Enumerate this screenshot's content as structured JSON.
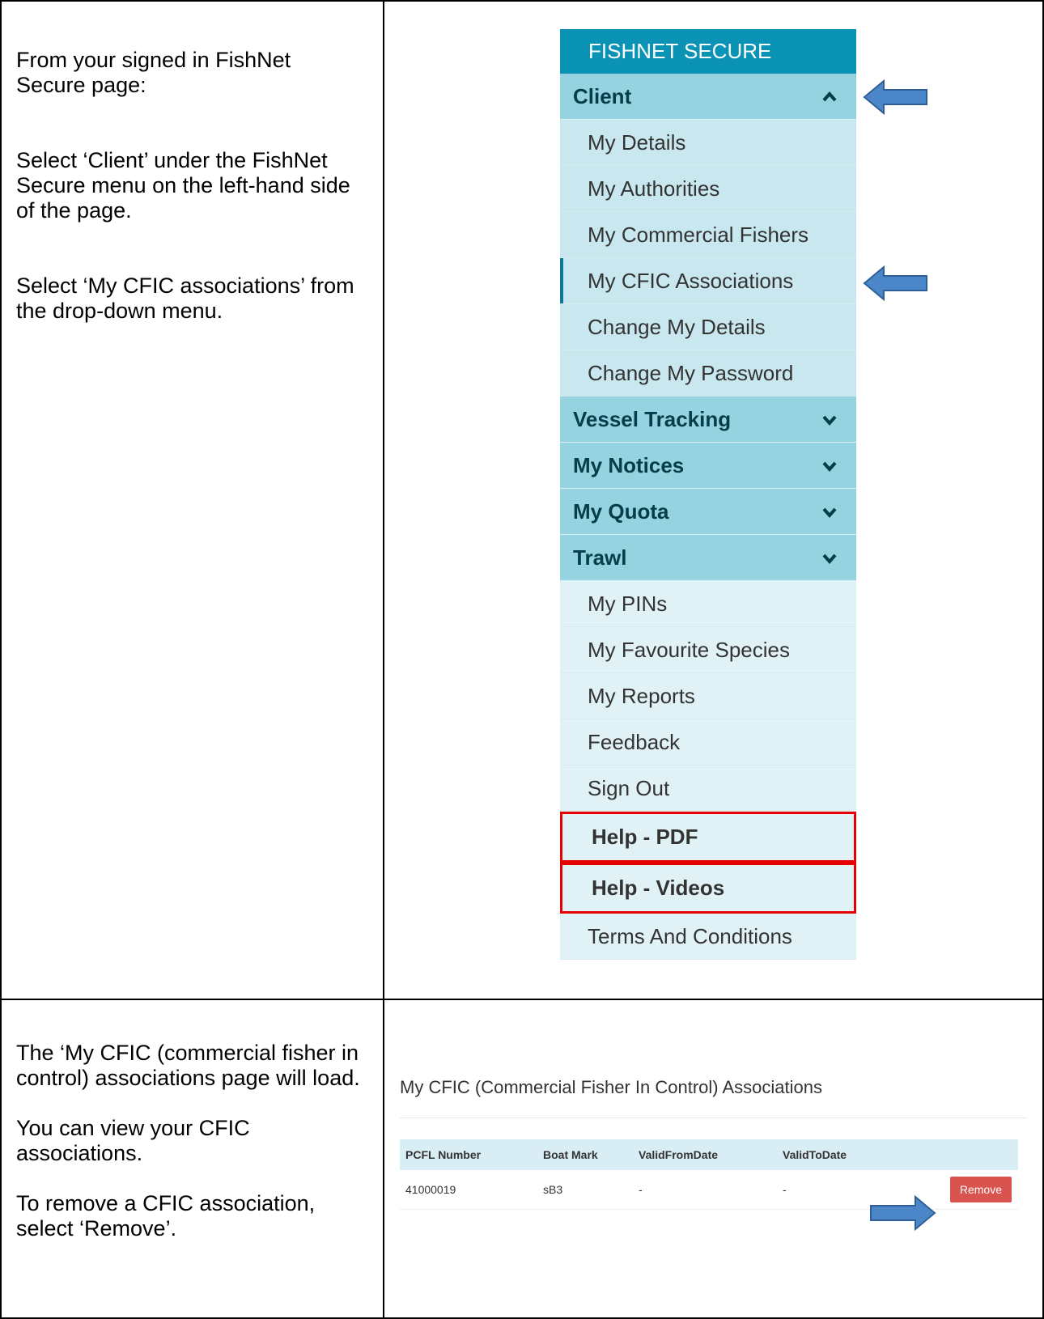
{
  "instructions": {
    "row1": {
      "p1": "From your signed in FishNet Secure page:",
      "p2": "Select ‘Client’ under the FishNet Secure menu on the left-hand side of the page.",
      "p3": "Select ‘My CFIC associations’ from the drop-down menu."
    },
    "row2": {
      "p1": "The ‘My CFIC (commercial fisher in control) associations page will load.",
      "p2": "You can view your CFIC associations.",
      "p3": "To remove a CFIC association, select ‘Remove’."
    }
  },
  "menu": {
    "brand": "FISHNET SECURE",
    "client": "Client",
    "client_items": [
      "My Details",
      "My Authorities",
      "My Commercial Fishers",
      "My CFIC Associations",
      "Change My Details",
      "Change My Password"
    ],
    "vessel_tracking": "Vessel Tracking",
    "my_notices": "My Notices",
    "my_quota": "My Quota",
    "trawl": "Trawl",
    "trawl_items": [
      "My PINs",
      "My Favourite Species",
      "My Reports",
      "Feedback",
      "Sign Out"
    ],
    "help_pdf": "Help - PDF",
    "help_videos": "Help - Videos",
    "terms": "Terms And Conditions"
  },
  "cfic": {
    "title": "My CFIC (Commercial Fisher In Control) Associations",
    "columns": [
      "PCFL Number",
      "Boat Mark",
      "ValidFromDate",
      "ValidToDate"
    ],
    "row": {
      "pcfl": "41000019",
      "boat_mark": "sB3",
      "valid_from": "-",
      "valid_to": "-"
    },
    "remove_label": "Remove"
  },
  "colors": {
    "brand_bg": "#0b93b6",
    "section_bg": "#94d3df",
    "arrow_fill": "#4a86c8",
    "help_border": "#e60000",
    "remove_bg": "#d9534f"
  },
  "icons": {
    "expanded": "chevron-up-icon",
    "collapsed": "chevron-down-icon",
    "pointer": "left-arrow-icon"
  }
}
